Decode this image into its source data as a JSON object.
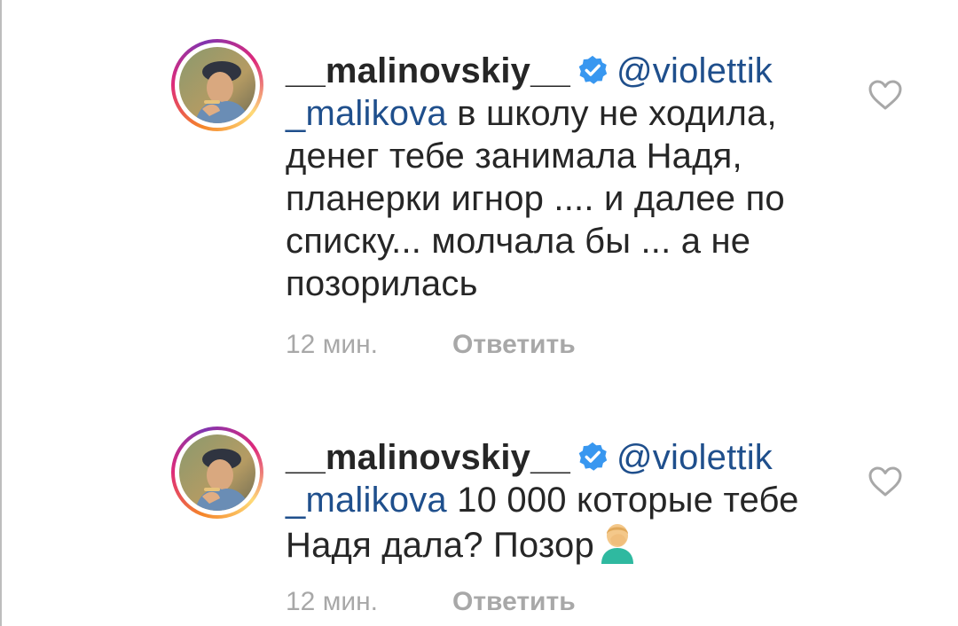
{
  "comments": [
    {
      "username": "__malinovskiy__",
      "mention": "@violettik _malikova",
      "text": " в школу не ходила, денег тебе занимала Надя, планерки игнор .... и далее по списку... молчала бы ... а не позорилась",
      "time": "12 мин.",
      "reply_label": "Ответить"
    },
    {
      "username": "__malinovskiy__",
      "mention": "@violettik _malikova",
      "text": " 10 000 которые тебе Надя дала? Позор",
      "time": "12 мин.",
      "reply_label": "Ответить"
    }
  ],
  "icons": {
    "verified": "verified-badge-icon",
    "like": "heart-outline-icon",
    "emoji": "facepalm-emoji"
  },
  "colors": {
    "text": "#262626",
    "mention": "#1f4f8c",
    "secondary": "#a8a8a8",
    "verified": "#3897f0"
  }
}
